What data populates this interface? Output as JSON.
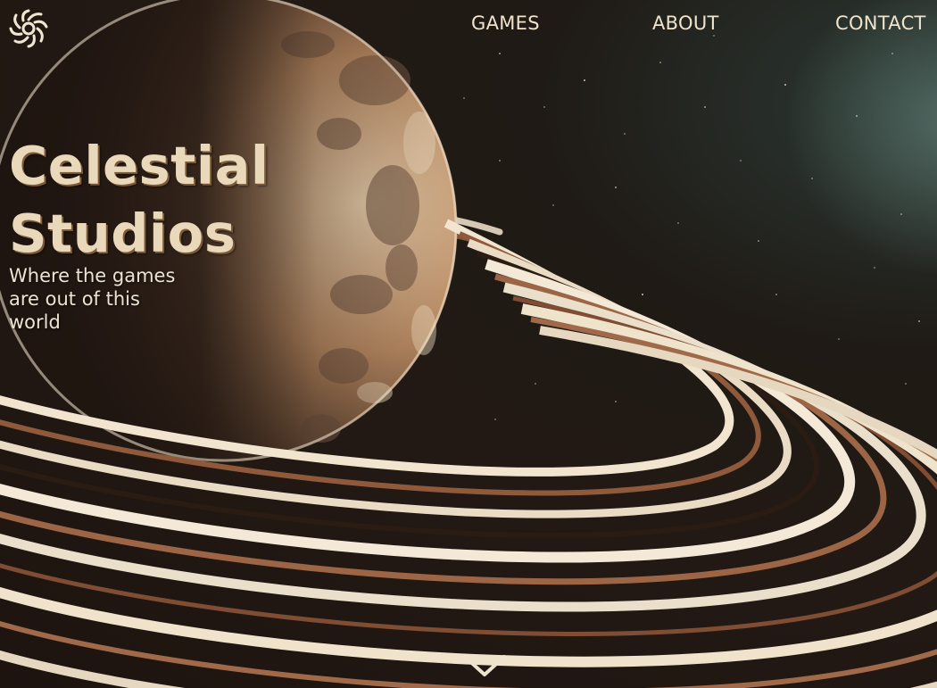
{
  "brand": {
    "logo_icon": "spiral-sun-icon",
    "title_line1": "Celestial",
    "title_line2": "Studios",
    "tagline": "Where the games are out of this world"
  },
  "nav": {
    "items": [
      {
        "label": "GAMES"
      },
      {
        "label": "ABOUT"
      },
      {
        "label": "CONTACT"
      }
    ]
  },
  "scroll_indicator": {
    "icon": "chevron-down-icon"
  },
  "colors": {
    "background": "#211812",
    "title": "#ead8ba",
    "title_shadow": "#7b5a3a",
    "nav_text": "#efe3cc",
    "ring_light": "#f2e6d2",
    "ring_brown": "#9b6545"
  }
}
